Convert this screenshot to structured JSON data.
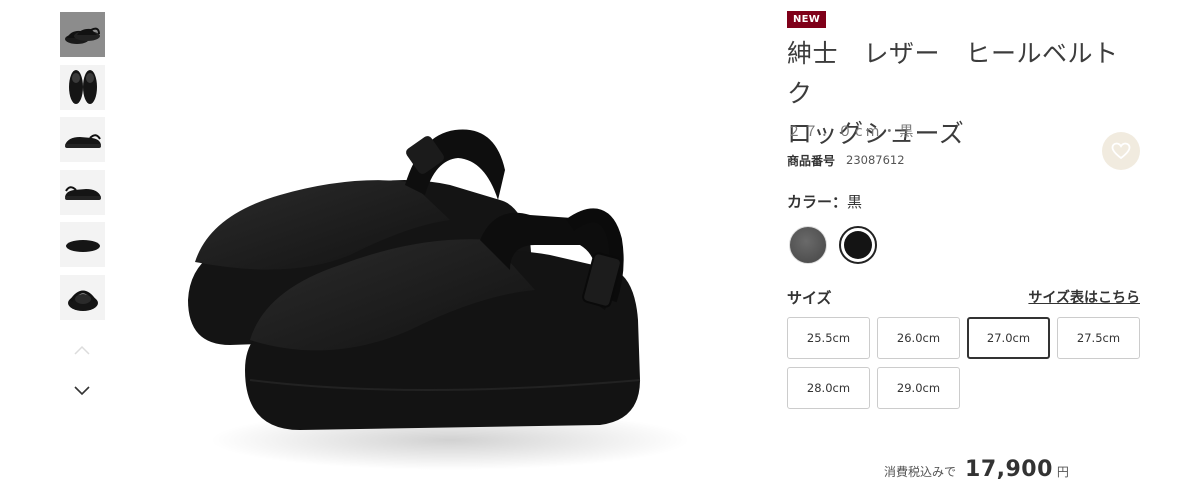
{
  "gallery": {
    "thumbnails": [
      {
        "view": "main-angle",
        "selected": true
      },
      {
        "view": "top",
        "selected": false
      },
      {
        "view": "side",
        "selected": false
      },
      {
        "view": "other-side",
        "selected": false
      },
      {
        "view": "sole",
        "selected": false
      },
      {
        "view": "back",
        "selected": false
      }
    ],
    "prev_icon": "chevron-up-icon",
    "next_icon": "chevron-down-icon"
  },
  "product": {
    "badge": "NEW",
    "title_line1": "紳士　レザー　ヒールベルトク",
    "title_line2": "ロッグシューズ",
    "subtitle": "２７．０cm・黒",
    "code_label": "商品番号",
    "code_value": "23087612",
    "favorite_icon": "heart-icon"
  },
  "color": {
    "label": "カラー：",
    "selected_name": "黒",
    "swatches": [
      {
        "name": "gray",
        "hex": "#555555",
        "selected": false
      },
      {
        "name": "black",
        "hex": "#141414",
        "selected": true
      }
    ]
  },
  "size": {
    "label": "サイズ",
    "chart_link": "サイズ表はこちら",
    "options": [
      "25.5cm",
      "26.0cm",
      "27.0cm",
      "27.5cm",
      "28.0cm",
      "29.0cm"
    ],
    "selected": "27.0cm"
  },
  "price": {
    "note": "消費税込みで",
    "value": "17,900",
    "unit": "円"
  },
  "colors": {
    "badge_bg": "#7f0019",
    "favorite_bg": "#f1ebdf"
  }
}
